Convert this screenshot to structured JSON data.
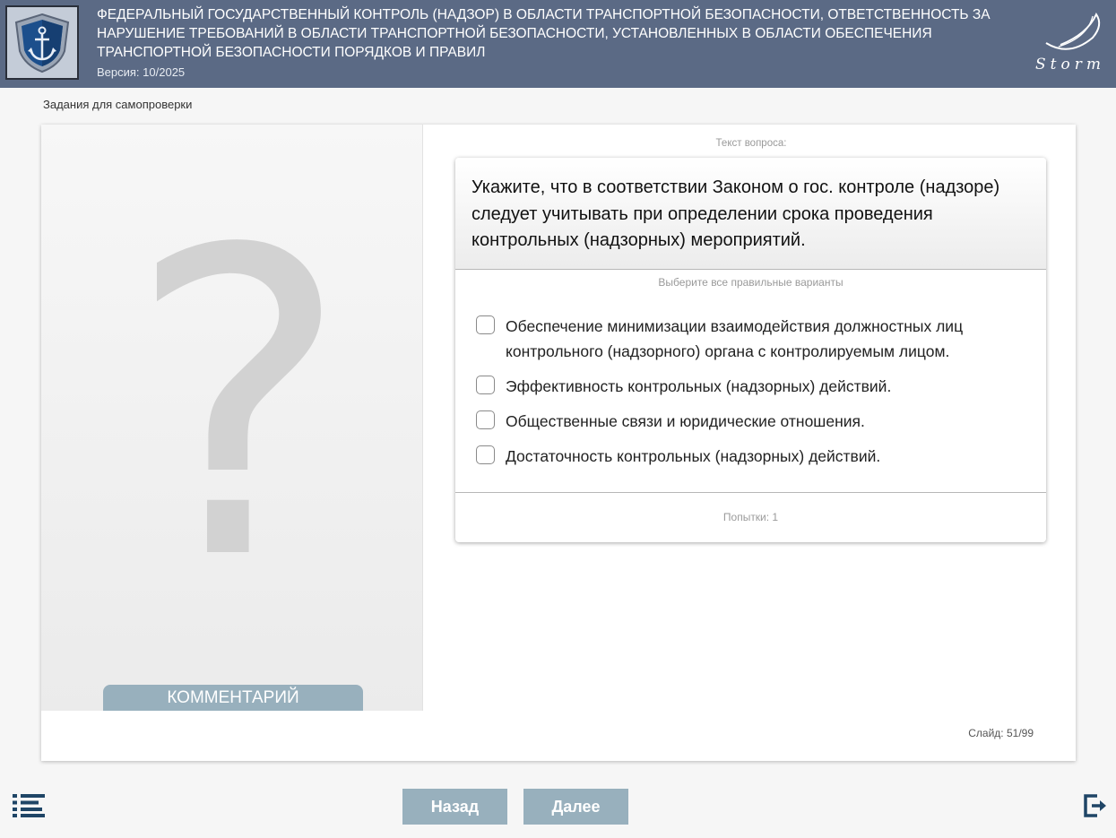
{
  "header": {
    "course_title": "ФЕДЕРАЛЬНЫЙ ГОСУДАРСТВЕННЫЙ КОНТРОЛЬ (НАДЗОР) В ОБЛАСТИ ТРАНСПОРТНОЙ БЕЗОПАСНОСТИ, ОТВЕТСТВЕННОСТЬ ЗА НАРУШЕНИЕ ТРЕБОВАНИЙ В ОБЛАСТИ ТРАНСПОРТНОЙ БЕЗОПАСНОСТИ, УСТАНОВЛЕННЫХ В ОБЛАСТИ ОБЕСПЕЧЕНИЯ ТРАНСПОРТНОЙ БЕЗОПАСНОСТИ ПОРЯДКОВ И ПРАВИЛ",
    "version": "Версия: 10/2025",
    "logo_icon": "anchor-shield-icon",
    "brand_text": "Storm"
  },
  "section_label": "Задания для самопроверки",
  "left_panel": {
    "placeholder_glyph": "?",
    "comment_button": "КОММЕНТАРИЙ"
  },
  "question": {
    "caption": "Текст вопроса:",
    "text": "Укажите, что в соответствии Законом о гос. контроле (надзоре) следует учитывать при определении срока проведения контрольных (надзорных) мероприятий.",
    "instruction": "Выберите все правильные варианты",
    "options": [
      {
        "label": "Обеспечение минимизации взаимодействия должностных лиц контрольного (надзорного) органа с контролируемым лицом.",
        "checked": false
      },
      {
        "label": "Эффективность контрольных (надзорных) действий.",
        "checked": false
      },
      {
        "label": "Общественные связи и юридические отношения.",
        "checked": false
      },
      {
        "label": "Достаточность контрольных (надзорных) действий.",
        "checked": false
      }
    ],
    "attempts": "Попытки: 1"
  },
  "slide_counter": "Слайд:  51/99",
  "navigation": {
    "back_label": "Назад",
    "next_label": "Далее",
    "menu_icon": "list-menu-icon",
    "exit_icon": "exit-icon"
  },
  "colors": {
    "header_bg": "#5b6a85",
    "button_bg": "#98b0bd",
    "icon_color": "#1f4566"
  }
}
